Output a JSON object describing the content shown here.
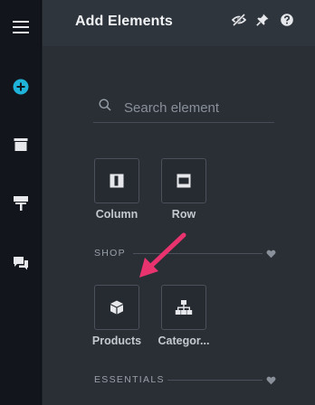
{
  "panel": {
    "title": "Add Elements"
  },
  "search": {
    "placeholder": "Search element",
    "value": ""
  },
  "layout_elements": [
    {
      "label": "Column",
      "icon": "column-icon"
    },
    {
      "label": "Row",
      "icon": "row-icon"
    }
  ],
  "sections": {
    "shop": {
      "label": "SHOP",
      "items": [
        {
          "label": "Products",
          "icon": "box-icon"
        },
        {
          "label": "Categor...",
          "icon": "sitemap-icon"
        }
      ]
    },
    "essentials": {
      "label": "ESSENTIALS"
    }
  },
  "colors": {
    "accent": "#1fb3d9",
    "arrow": "#e8336f",
    "panel_bg": "#2a2f36",
    "rail_bg": "#12161c"
  }
}
